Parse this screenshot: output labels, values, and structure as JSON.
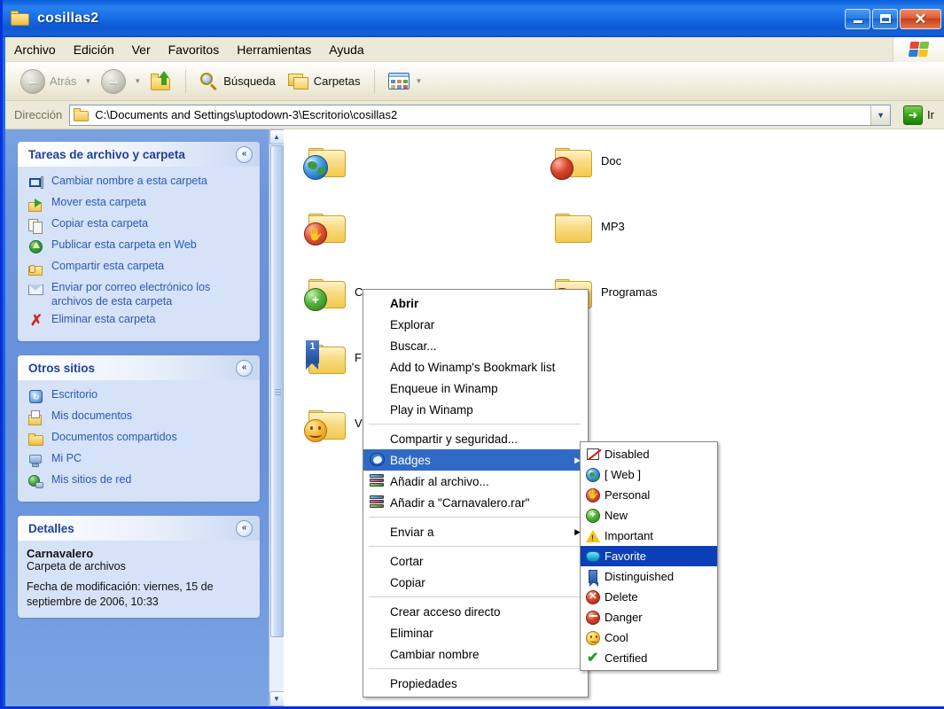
{
  "window": {
    "title": "cosillas2",
    "buttons": {
      "minimize": "_",
      "maximize": "□",
      "close": "✕"
    }
  },
  "menubar": {
    "items": [
      "Archivo",
      "Edición",
      "Ver",
      "Favoritos",
      "Herramientas",
      "Ayuda"
    ]
  },
  "toolbar": {
    "back_label": "Atrás",
    "search_label": "Búsqueda",
    "folders_label": "Carpetas"
  },
  "address": {
    "label": "Dirección",
    "value": "C:\\Documents and Settings\\uptodown-3\\Escritorio\\cosillas2",
    "go_label": "Ir"
  },
  "sidebar": {
    "panels": [
      {
        "title": "Tareas de archivo y carpeta",
        "collapse": "«",
        "items": [
          {
            "label": "Cambiar nombre a esta carpeta",
            "icon": "rename-icon"
          },
          {
            "label": "Mover esta carpeta",
            "icon": "move-icon"
          },
          {
            "label": "Copiar esta carpeta",
            "icon": "copy-icon"
          },
          {
            "label": "Publicar esta carpeta en Web",
            "icon": "publish-web-icon"
          },
          {
            "label": "Compartir esta carpeta",
            "icon": "share-icon"
          },
          {
            "label": "Enviar por correo electrónico los archivos de esta carpeta",
            "icon": "mail-icon"
          },
          {
            "label": "Eliminar esta carpeta",
            "icon": "delete-icon"
          }
        ]
      },
      {
        "title": "Otros sitios",
        "collapse": "«",
        "items": [
          {
            "label": "Escritorio",
            "icon": "desktop-icon"
          },
          {
            "label": "Mis documentos",
            "icon": "my-documents-icon"
          },
          {
            "label": "Documentos compartidos",
            "icon": "shared-documents-icon"
          },
          {
            "label": "Mi PC",
            "icon": "my-pc-icon"
          },
          {
            "label": "Mis sitios de red",
            "icon": "network-places-icon"
          }
        ]
      },
      {
        "title": "Detalles",
        "collapse": "«",
        "detail_name": "Carnavalero",
        "detail_type": "Carpeta de archivos",
        "detail_modified": "Fecha de modificación: viernes, 15 de septiembre de 2006, 10:33"
      }
    ]
  },
  "filelist": {
    "items": [
      {
        "label": "",
        "badge": "web",
        "hidden_label": ""
      },
      {
        "label": "",
        "badge": "personal",
        "hidden_label": ""
      },
      {
        "label": "C",
        "badge": "new",
        "hidden_label": "C"
      },
      {
        "label": "F",
        "badge": "distinguished",
        "hidden_label": "F"
      },
      {
        "label": "V",
        "badge": "cool",
        "hidden_label": "V"
      },
      {
        "label": "Doc",
        "badge": "danger",
        "hidden_label": "Doc"
      },
      {
        "label": "MP3",
        "badge": "none",
        "hidden_label": "MP3"
      },
      {
        "label": "Programas",
        "badge": "danger",
        "hidden_label": "Programas"
      }
    ]
  },
  "context_menu": {
    "items": [
      {
        "label": "Abrir",
        "bold": true,
        "icon": "none"
      },
      {
        "label": "Explorar",
        "bold": false,
        "icon": "none"
      },
      {
        "label": "Buscar...",
        "bold": false,
        "icon": "none"
      },
      {
        "label": "Add to Winamp's Bookmark list",
        "bold": false,
        "icon": "none"
      },
      {
        "label": "Enqueue in Winamp",
        "bold": false,
        "icon": "none"
      },
      {
        "label": "Play in Winamp",
        "bold": false,
        "icon": "none"
      },
      {
        "separator": true
      },
      {
        "label": "Compartir y seguridad...",
        "bold": false,
        "icon": "none"
      },
      {
        "label": "Badges",
        "bold": false,
        "icon": "badges-icon",
        "selected": true,
        "submenu": true,
        "arrow": "▶"
      },
      {
        "label": "Añadir al archivo...",
        "bold": false,
        "icon": "winrar-icon"
      },
      {
        "label": "Añadir a \"Carnavalero.rar\"",
        "bold": false,
        "icon": "winrar-icon"
      },
      {
        "separator": true
      },
      {
        "label": "Enviar a",
        "bold": false,
        "icon": "none",
        "submenu": true,
        "arrow": "▶"
      },
      {
        "separator": true
      },
      {
        "label": "Cortar",
        "bold": false,
        "icon": "none"
      },
      {
        "label": "Copiar",
        "bold": false,
        "icon": "none"
      },
      {
        "separator": true
      },
      {
        "label": "Crear acceso directo",
        "bold": false,
        "icon": "none"
      },
      {
        "label": "Eliminar",
        "bold": false,
        "icon": "none"
      },
      {
        "label": "Cambiar nombre",
        "bold": false,
        "icon": "none"
      },
      {
        "separator": true
      },
      {
        "label": "Propiedades",
        "bold": false,
        "icon": "none"
      }
    ]
  },
  "badges_submenu": {
    "items": [
      {
        "label": "Disabled",
        "icon": "disabled-icon",
        "selected": false
      },
      {
        "label": "[ Web ]",
        "icon": "web-globe-icon",
        "selected": false
      },
      {
        "label": "Personal",
        "icon": "personal-icon",
        "selected": false
      },
      {
        "label": "New",
        "icon": "new-plus-icon",
        "selected": false
      },
      {
        "label": "Important",
        "icon": "important-warning-icon",
        "selected": false
      },
      {
        "label": "Favorite",
        "icon": "favorite-heart-icon",
        "selected": true
      },
      {
        "label": "Distinguished",
        "icon": "distinguished-bookmark-icon",
        "selected": false
      },
      {
        "label": "Delete",
        "icon": "delete-x-icon",
        "selected": false
      },
      {
        "label": "Danger",
        "icon": "danger-minus-icon",
        "selected": false
      },
      {
        "label": "Cool",
        "icon": "cool-smiley-icon",
        "selected": false
      },
      {
        "label": "Certified",
        "icon": "certified-check-icon",
        "selected": false
      }
    ]
  },
  "colors": {
    "title_blue": "#0a5fd8",
    "selection_blue": "#316ac5",
    "submenu_selection": "#0a3fb8",
    "sidebar_blue": "#6d95dc",
    "panel_bg": "#d6e2f7",
    "client_bg": "#ece9d8",
    "link_blue": "#2a58b8"
  }
}
